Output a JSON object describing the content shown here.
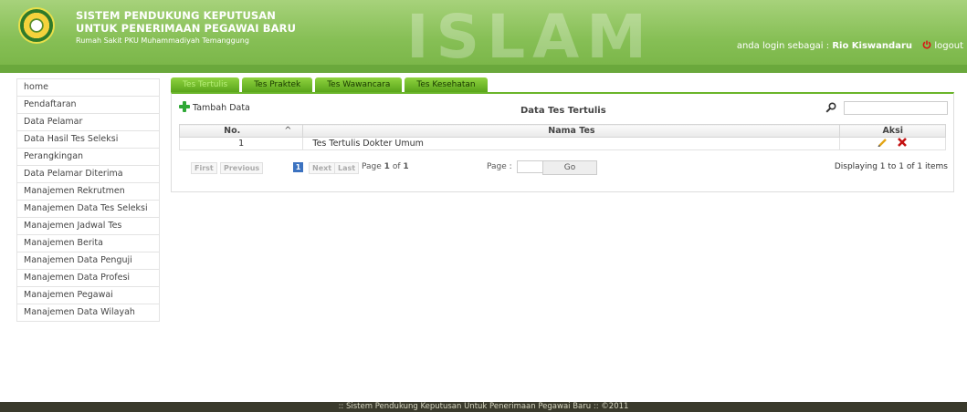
{
  "header": {
    "title_line1": "SISTEM PENDUKUNG KEPUTUSAN",
    "title_line2": "UNTUK PENERIMAAN PEGAWAI BARU",
    "subtitle": "Rumah Sakit PKU Muhammadiyah Temanggung",
    "watermark": "ISLAM",
    "login_prefix": "anda login sebagai :",
    "user": "Rio Kiswandaru",
    "logout": "logout"
  },
  "sidebar": {
    "items": [
      {
        "label": "home"
      },
      {
        "label": "Pendaftaran"
      },
      {
        "label": "Data Pelamar"
      },
      {
        "label": "Data Hasil Tes Seleksi"
      },
      {
        "label": "Perangkingan"
      },
      {
        "label": "Data Pelamar Diterima"
      },
      {
        "label": "Manajemen Rekrutmen"
      },
      {
        "label": "Manajemen Data Tes Seleksi"
      },
      {
        "label": "Manajemen Jadwal Tes"
      },
      {
        "label": "Manajemen Berita"
      },
      {
        "label": "Manajemen Data Penguji"
      },
      {
        "label": "Manajemen Data Profesi"
      },
      {
        "label": "Manajemen Pegawai"
      },
      {
        "label": "Manajemen Data Wilayah"
      }
    ]
  },
  "tabs": [
    {
      "label": "Tes Tertulis",
      "active": true
    },
    {
      "label": "Tes Praktek"
    },
    {
      "label": "Tes Wawancara"
    },
    {
      "label": "Tes Kesehatan"
    }
  ],
  "panel": {
    "add_label": "Tambah Data",
    "grid_title": "Data Tes Tertulis",
    "search_value": "",
    "columns": {
      "no": "No.",
      "sort_indicator": "^",
      "nama": "Nama Tes",
      "aksi": "Aksi"
    },
    "rows": [
      {
        "no": "1",
        "nama": "Tes Tertulis Dokter Umum"
      }
    ],
    "pager": {
      "first": "First",
      "previous": "Previous",
      "current": "1",
      "next": "Next",
      "last": "Last",
      "page_prefix": "Page",
      "page_num": "1",
      "page_of": "of",
      "page_total": "1",
      "page_label": "Page :",
      "go": "Go",
      "display": "Displaying 1 to 1 of 1 items"
    }
  },
  "footer": {
    "text": ":: Sistem Pendukung Keputusan Untuk Penerimaan Pegawai Baru :: ©2011"
  }
}
